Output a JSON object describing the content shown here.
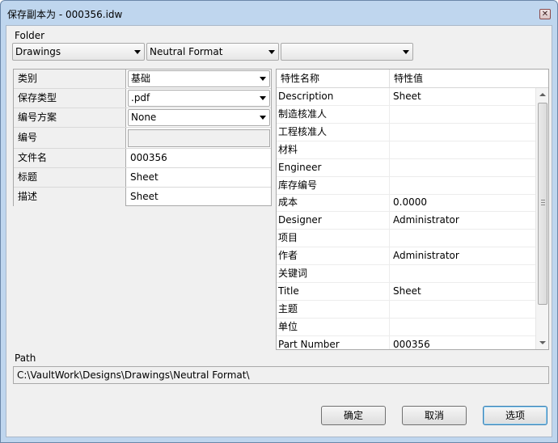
{
  "window": {
    "title": "保存副本为 - 000356.idw",
    "close_symbol": "✕"
  },
  "folder": {
    "label": "Folder",
    "combos": [
      {
        "value": "Drawings"
      },
      {
        "value": "Neutral Format"
      },
      {
        "value": ""
      }
    ]
  },
  "properties": [
    {
      "name": "类别",
      "value": "基础",
      "type": "combo"
    },
    {
      "name": "保存类型",
      "value": ".pdf",
      "type": "combo"
    },
    {
      "name": "编号方案",
      "value": "None",
      "type": "combo"
    },
    {
      "name": "编号",
      "value": "",
      "type": "disabled"
    },
    {
      "name": "文件名",
      "value": "000356",
      "type": "text"
    },
    {
      "name": "标题",
      "value": "Sheet",
      "type": "text"
    },
    {
      "name": "描述",
      "value": "Sheet",
      "type": "text"
    }
  ],
  "attributes": {
    "headers": [
      "特性名称",
      "特性值"
    ],
    "rows": [
      [
        "Description",
        "Sheet"
      ],
      [
        "制造核准人",
        ""
      ],
      [
        "工程核准人",
        ""
      ],
      [
        "材料",
        ""
      ],
      [
        "Engineer",
        ""
      ],
      [
        "库存编号",
        ""
      ],
      [
        "成本",
        "0.0000"
      ],
      [
        "Designer",
        "Administrator"
      ],
      [
        "项目",
        ""
      ],
      [
        "作者",
        "Administrator"
      ],
      [
        "关键词",
        ""
      ],
      [
        "Title",
        "Sheet"
      ],
      [
        "主题",
        ""
      ],
      [
        "单位",
        ""
      ],
      [
        "Part Number",
        "000356"
      ]
    ]
  },
  "path": {
    "label": "Path",
    "value": "C:\\VaultWork\\Designs\\Drawings\\Neutral Format\\"
  },
  "buttons": {
    "ok": "确定",
    "cancel": "取消",
    "options": "选项"
  }
}
